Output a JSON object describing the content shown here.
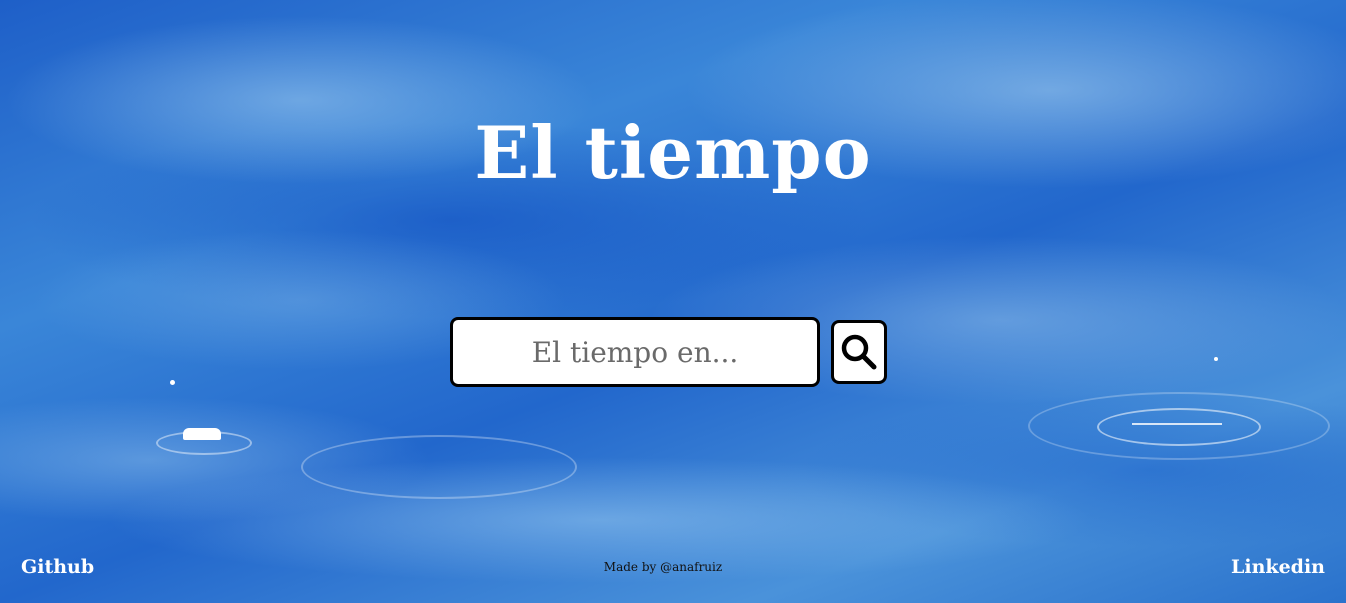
{
  "page": {
    "title": "El tiempo"
  },
  "search": {
    "placeholder": "El tiempo en...",
    "value": "",
    "button_icon": "search-icon"
  },
  "footer": {
    "github_label": "Github",
    "credit": "Made by @anafruiz",
    "linkedin_label": "Linkedin"
  },
  "colors": {
    "sky_blue": "#2a72cc",
    "title_text": "#ffffff",
    "border": "#000000"
  }
}
